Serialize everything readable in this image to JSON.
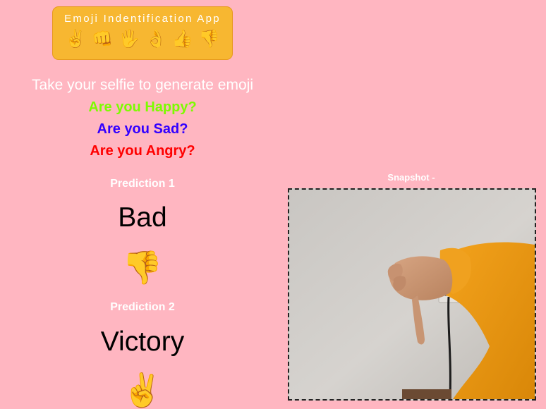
{
  "header": {
    "title": "Emoji Indentification App",
    "emojis": [
      "✌️",
      "👊",
      "🖐️",
      "👌",
      "👍",
      "👎"
    ]
  },
  "intro": {
    "tagline": "Take your selfie to generate emoji",
    "questions": {
      "happy": "Are you Happy?",
      "sad": "Are you Sad?",
      "angry": "Are you Angry?"
    },
    "colors": {
      "happy": "#7cfc00",
      "sad": "#3300ff",
      "angry": "#ff0000",
      "background": "#ffb6c1",
      "header": "#f7b731"
    }
  },
  "predictions": [
    {
      "label": "Prediction 1",
      "value": "Bad",
      "emoji": "👎"
    },
    {
      "label": "Prediction 2",
      "value": "Victory",
      "emoji": "✌️"
    }
  ],
  "snapshot": {
    "label": "Snapshot -",
    "image_description": "thumbs-down hand gesture photo"
  }
}
